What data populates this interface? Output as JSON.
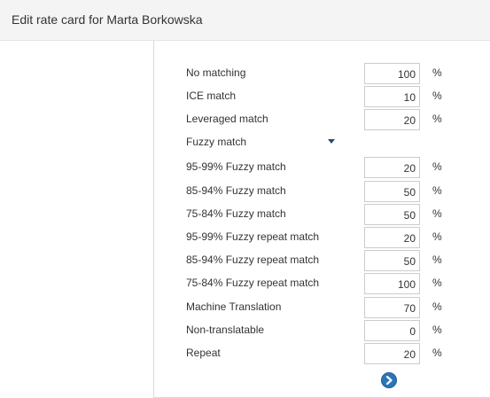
{
  "header": {
    "title": "Edit rate card for Marta Borkowska"
  },
  "rates": {
    "no_matching": {
      "label": "No matching",
      "value": "100",
      "unit": "%"
    },
    "ice_match": {
      "label": "ICE match",
      "value": "10",
      "unit": "%"
    },
    "leveraged_match": {
      "label": "Leveraged match",
      "value": "20",
      "unit": "%"
    },
    "fuzzy_match": {
      "label": "Fuzzy match"
    },
    "fuzzy_95_99": {
      "label": "95-99% Fuzzy match",
      "value": "20",
      "unit": "%"
    },
    "fuzzy_85_94": {
      "label": "85-94% Fuzzy match",
      "value": "50",
      "unit": "%"
    },
    "fuzzy_75_84": {
      "label": "75-84% Fuzzy match",
      "value": "50",
      "unit": "%"
    },
    "fuzzy_repeat_95_99": {
      "label": "95-99% Fuzzy repeat match",
      "value": "20",
      "unit": "%"
    },
    "fuzzy_repeat_85_94": {
      "label": "85-94% Fuzzy repeat match",
      "value": "50",
      "unit": "%"
    },
    "fuzzy_repeat_75_84": {
      "label": "75-84% Fuzzy repeat match",
      "value": "100",
      "unit": "%"
    },
    "machine_translation": {
      "label": "Machine Translation",
      "value": "70",
      "unit": "%"
    },
    "non_translatable": {
      "label": "Non-translatable",
      "value": "0",
      "unit": "%"
    },
    "repeat": {
      "label": "Repeat",
      "value": "20",
      "unit": "%"
    }
  },
  "icons": {
    "fuzzy_toggle": "caret-down-icon",
    "next": "chevron-right-circle-icon"
  },
  "colors": {
    "accent": "#2b75b8",
    "caret": "#1f4e79"
  }
}
